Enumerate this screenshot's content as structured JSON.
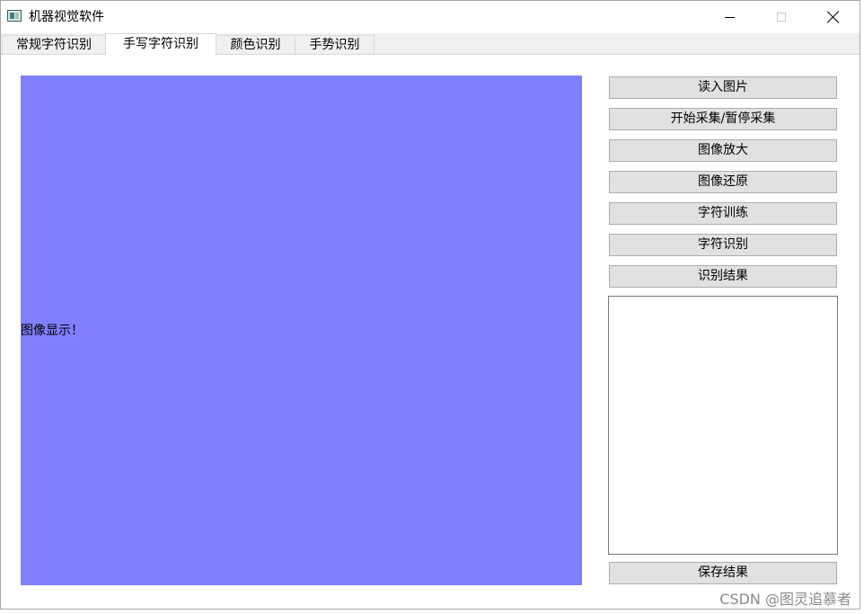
{
  "window": {
    "title": "机器视觉软件",
    "icons": {
      "app": "app-window-icon",
      "minimize": "minimize-icon",
      "maximize": "maximize-icon",
      "close": "close-icon"
    }
  },
  "tabs": [
    {
      "label": "常规字符识别",
      "active": false
    },
    {
      "label": "手写字符识别",
      "active": true
    },
    {
      "label": "颜色识别",
      "active": false
    },
    {
      "label": "手势识别",
      "active": false
    }
  ],
  "display": {
    "label": "图像显示！",
    "background": "#807fff"
  },
  "buttons": {
    "read_image": "读入图片",
    "start_pause_capture": "开始采集/暂停采集",
    "zoom_in": "图像放大",
    "restore": "图像还原",
    "train_chars": "字符训练",
    "recognize_chars": "字符识别",
    "recognition_result": "识别结果",
    "save_result": "保存结果"
  },
  "result_text": "",
  "watermark": "CSDN @图灵追慕者"
}
